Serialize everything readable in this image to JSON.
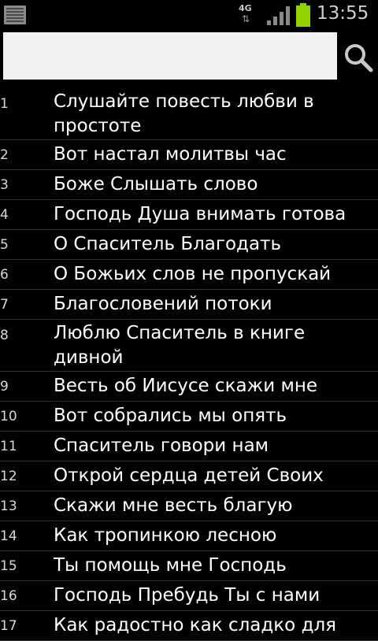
{
  "statusbar": {
    "network": "4G",
    "time": "13:55",
    "icons": [
      "menu-icon",
      "network-4g-icon",
      "signal-strength-icon",
      "battery-icon"
    ],
    "colors": {
      "battery": "#8fd400",
      "status_text": "#d0d0d0"
    }
  },
  "search": {
    "value": "",
    "placeholder": "",
    "icon": "search-icon"
  },
  "list": {
    "items": [
      {
        "num": "1",
        "title": "Слушайте повесть любви в простоте"
      },
      {
        "num": "2",
        "title": "Вот настал молитвы час"
      },
      {
        "num": "3",
        "title": "Боже Слышать слово"
      },
      {
        "num": "4",
        "title": "Господь Душа внимать готова"
      },
      {
        "num": "5",
        "title": "О Спаситель Благодать"
      },
      {
        "num": "6",
        "title": "О Божьих слов не пропускай"
      },
      {
        "num": "7",
        "title": "Благословений потоки"
      },
      {
        "num": "8",
        "title": "Люблю Спаситель в книге дивной"
      },
      {
        "num": "9",
        "title": "Весть об Иисусе скажи мне"
      },
      {
        "num": "10",
        "title": "Вот собрались мы опять"
      },
      {
        "num": "11",
        "title": "Спаситель говори нам"
      },
      {
        "num": "12",
        "title": "Открой сердца детей Своих"
      },
      {
        "num": "13",
        "title": "Скажи мне весть благую"
      },
      {
        "num": "14",
        "title": "Как тропинкою лесною"
      },
      {
        "num": "15",
        "title": "Ты помощь мне Господь"
      },
      {
        "num": "16",
        "title": "Господь Пребудь Ты с нами"
      },
      {
        "num": "17",
        "title": "Как радостно как сладко для"
      }
    ]
  }
}
